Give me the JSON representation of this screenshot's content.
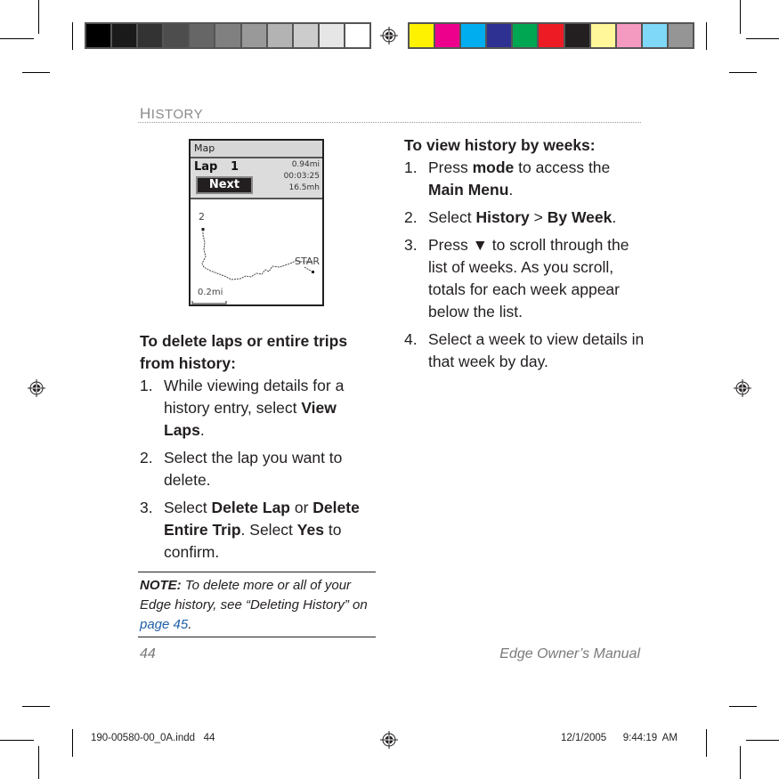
{
  "color_bars": {
    "grayscale": [
      "#000000",
      "#1a1a1a",
      "#333333",
      "#4d4d4d",
      "#666666",
      "#808080",
      "#999999",
      "#b3b3b3",
      "#cccccc",
      "#e6e6e6",
      "#ffffff"
    ],
    "process": [
      "#fff200",
      "#ec008c",
      "#00aeef",
      "#2e3192",
      "#00a651",
      "#ed1c24",
      "#231f20",
      "#fff799",
      "#f49ac1",
      "#7fd8f7",
      "#959595"
    ]
  },
  "section": {
    "title_first": "H",
    "title_rest": "ISTORY"
  },
  "device": {
    "title": "Map",
    "lap_label": "Lap",
    "lap_number": "1",
    "next_button": "Next",
    "stats": [
      "0.94mi",
      "00:03:25",
      "16.5mh"
    ],
    "waypoint_label": "2",
    "start_label": "STAR",
    "scale_label": "0.2mi"
  },
  "left_column": {
    "heading": "To delete laps or entire trips from history:",
    "steps": [
      {
        "num": "1.",
        "parts": [
          {
            "t": "While viewing details for a history entry, select "
          },
          {
            "t": "View Laps",
            "b": true
          },
          {
            "t": "."
          }
        ]
      },
      {
        "num": "2.",
        "parts": [
          {
            "t": "Select the lap you want to delete."
          }
        ]
      },
      {
        "num": "3.",
        "parts": [
          {
            "t": "Select "
          },
          {
            "t": "Delete Lap",
            "b": true
          },
          {
            "t": " or "
          },
          {
            "t": "Delete Entire Trip",
            "b": true
          },
          {
            "t": ". Select "
          },
          {
            "t": "Yes",
            "b": true
          },
          {
            "t": " to confirm."
          }
        ]
      }
    ]
  },
  "note": {
    "label": "NOTE:",
    "text": " To delete more or all of your Edge history, see “Deleting History” on ",
    "link": "page 45",
    "end": "."
  },
  "right_column": {
    "heading": "To view history by weeks:",
    "steps": [
      {
        "num": "1.",
        "parts": [
          {
            "t": "Press "
          },
          {
            "t": "mode",
            "b": true
          },
          {
            "t": " to access the "
          },
          {
            "t": "Main Menu",
            "b": true
          },
          {
            "t": "."
          }
        ]
      },
      {
        "num": "2.",
        "parts": [
          {
            "t": "Select "
          },
          {
            "t": "History",
            "b": true
          },
          {
            "t": " > "
          },
          {
            "t": "By Week",
            "b": true
          },
          {
            "t": "."
          }
        ]
      },
      {
        "num": "3.",
        "parts": [
          {
            "t": "Press "
          },
          {
            "t": "▼",
            "b": true
          },
          {
            "t": " to scroll through the list of weeks. As you scroll, totals for each week appear below the list."
          }
        ]
      },
      {
        "num": "4.",
        "parts": [
          {
            "t": "Select a week to view details in that week by day."
          }
        ]
      }
    ]
  },
  "footer": {
    "page_number": "44",
    "manual_title": "Edge Owner’s Manual"
  },
  "slug": {
    "file": "190-00580-00_0A.indd   44",
    "timestamp": "12/1/2005   9:44:19 AM"
  }
}
